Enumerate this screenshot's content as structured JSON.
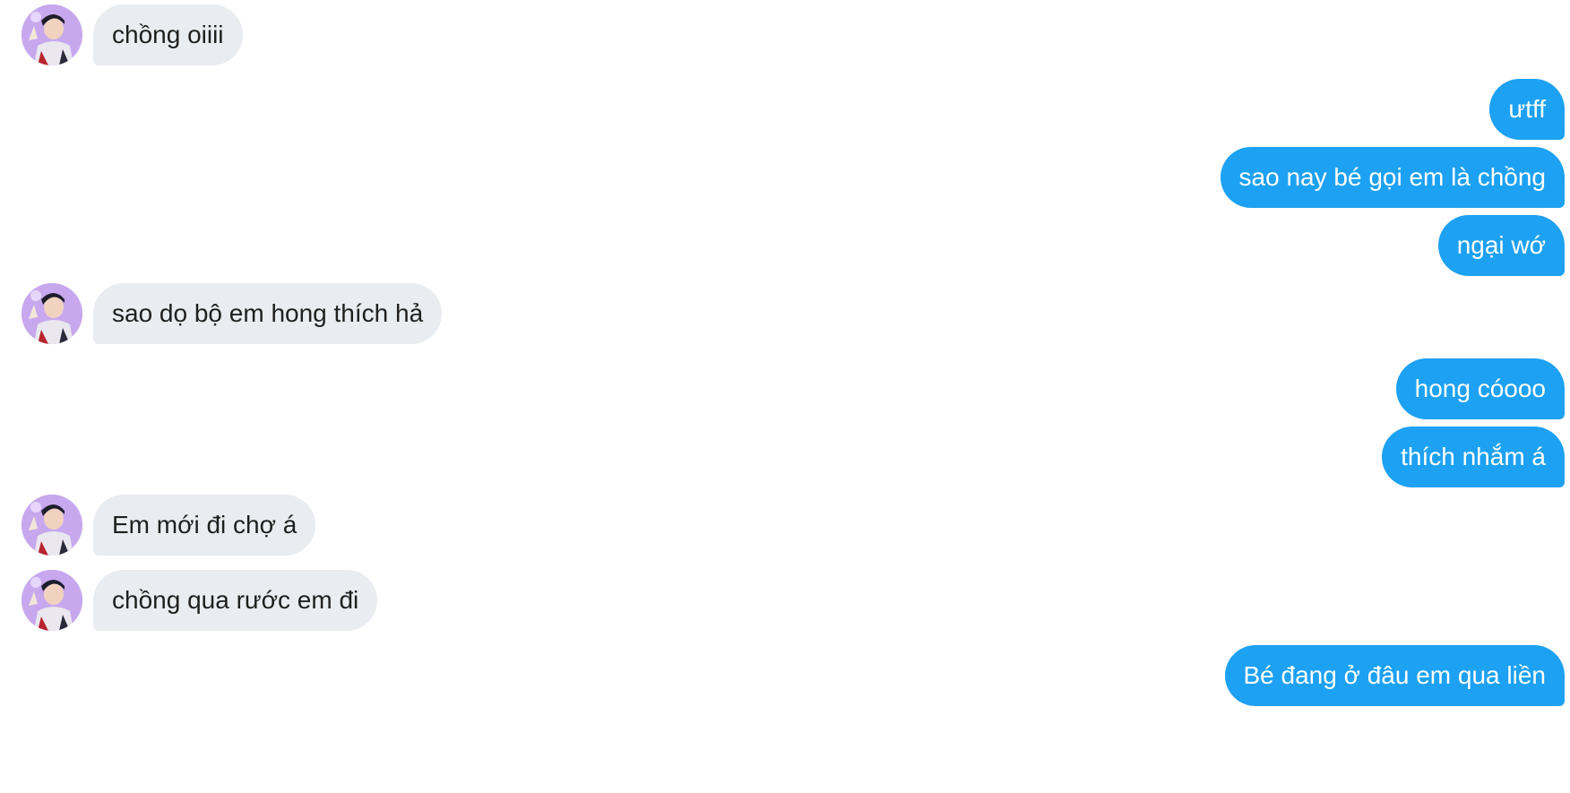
{
  "conversation": {
    "messages": [
      {
        "side": "in",
        "text": "chồng oiiii"
      },
      {
        "side": "out",
        "text": "ưtff"
      },
      {
        "side": "out",
        "text": "sao nay bé gọi em là chồng"
      },
      {
        "side": "out",
        "text": "ngại wớ"
      },
      {
        "side": "in",
        "text": "sao dọ bộ em hong thích hả"
      },
      {
        "side": "out",
        "text": "hong cóooo"
      },
      {
        "side": "out",
        "text": "thích nhắm á"
      },
      {
        "side": "in",
        "text": "Em mới đi chợ á"
      },
      {
        "side": "in",
        "text": "chồng qua rước em đi"
      },
      {
        "side": "out",
        "text": "Bé đang ở đâu em qua liền"
      }
    ]
  },
  "colors": {
    "incoming_bubble": "#e9ecf0",
    "outgoing_bubble": "#1da1f2",
    "avatar_background": "#c7a8ee"
  },
  "icons": {
    "avatar": "contact-avatar-photo"
  }
}
